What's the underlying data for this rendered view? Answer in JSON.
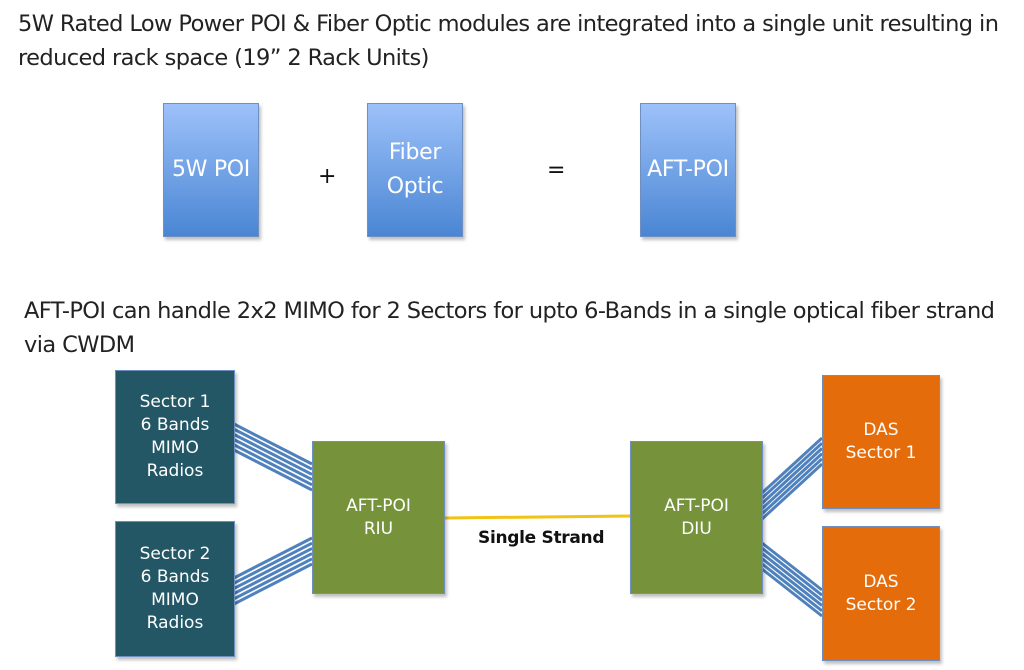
{
  "intro": {
    "text": "5W Rated Low Power POI & Fiber Optic modules are integrated into a single unit resulting in reduced rack space (19” 2 Rack Units)"
  },
  "equation": {
    "left_box": "5W POI",
    "plus": "+",
    "middle_box": [
      "Fiber",
      "Optic"
    ],
    "equals": "=",
    "result_box": "AFT-POI"
  },
  "capability": {
    "text": "AFT-POI can handle 2x2 MIMO for 2 Sectors for upto 6-Bands in a single optical fiber strand via CWDM"
  },
  "diagram": {
    "sources": [
      {
        "lines": [
          "Sector 1",
          "6 Bands",
          "MIMO",
          "Radios"
        ]
      },
      {
        "lines": [
          "Sector 2",
          "6 Bands",
          "MIMO",
          "Radios"
        ]
      }
    ],
    "riu": {
      "lines": [
        "AFT-POI",
        "RIU"
      ]
    },
    "diu": {
      "lines": [
        "AFT-POI",
        "DIU"
      ]
    },
    "link_label": "Single Strand",
    "destinations": [
      {
        "lines": [
          "DAS",
          "Sector 1"
        ]
      },
      {
        "lines": [
          "DAS",
          "Sector 2"
        ]
      }
    ],
    "cable_count": 6,
    "colors": {
      "source": "#235766",
      "unit": "#76933b",
      "destination": "#e46c0a",
      "module_top": "#9dc1fa",
      "module_bottom": "#4a86d3",
      "cable": "#4f81bd",
      "fiber": "#f2c314"
    }
  }
}
